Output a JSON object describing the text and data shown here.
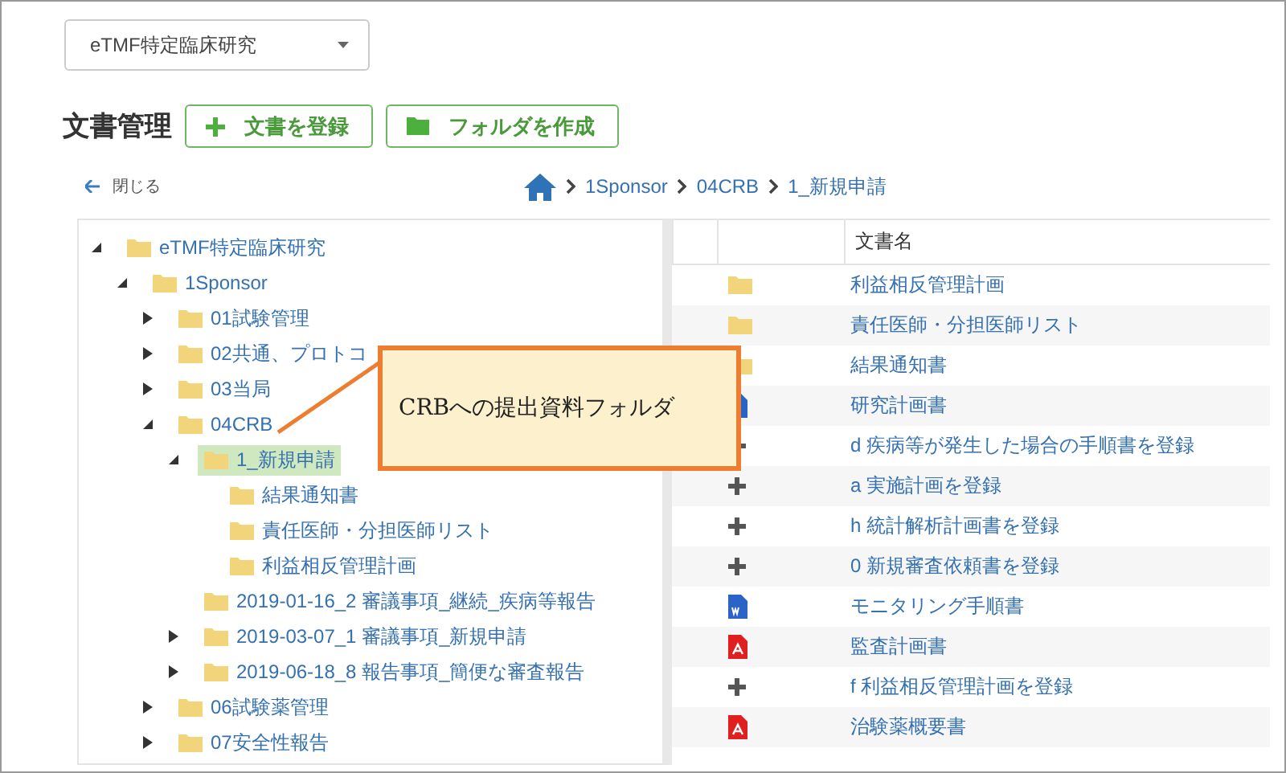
{
  "project_select": {
    "value": "eTMF特定臨床研究"
  },
  "page_title": "文書管理",
  "actions": [
    {
      "label": "文書を登録",
      "kind": "add"
    },
    {
      "label": "フォルダを作成",
      "kind": "folder"
    }
  ],
  "close_link": "閉じる",
  "breadcrumb": [
    "1Sponsor",
    "04CRB",
    "1_新規申請"
  ],
  "tree": [
    {
      "label": "eTMF特定臨床研究",
      "expanded": true,
      "selected": false,
      "children": [
        {
          "label": "1Sponsor",
          "expanded": true,
          "selected": false,
          "children": [
            {
              "label": "01試験管理",
              "expanded": false,
              "selected": false
            },
            {
              "label": "02共通、プロトコ",
              "expanded": false,
              "selected": false
            },
            {
              "label": "03当局",
              "expanded": false,
              "selected": false
            },
            {
              "label": "04CRB",
              "expanded": true,
              "selected": false,
              "children": [
                {
                  "label": "1_新規申請",
                  "expanded": true,
                  "selected": true,
                  "children": [
                    {
                      "label": "結果通知書",
                      "selected": false
                    },
                    {
                      "label": "責任医師・分担医師リスト",
                      "selected": false
                    },
                    {
                      "label": "利益相反管理計画",
                      "selected": false
                    }
                  ]
                },
                {
                  "label": "2019-01-16_2 審議事項_継続_疾病等報告",
                  "selected": false
                },
                {
                  "label": "2019-03-07_1 審議事項_新規申請",
                  "expanded": false,
                  "selected": false
                },
                {
                  "label": "2019-06-18_8 報告事項_簡便な審査報告",
                  "expanded": false,
                  "selected": false
                }
              ]
            },
            {
              "label": "06試験薬管理",
              "expanded": false,
              "selected": false
            },
            {
              "label": "07安全性報告",
              "expanded": false,
              "selected": false
            }
          ]
        }
      ]
    }
  ],
  "table": {
    "columns": [
      "文書名"
    ],
    "rows": [
      {
        "kind": "folder",
        "name": "利益相反管理計画"
      },
      {
        "kind": "folder",
        "name": "責任医師・分担医師リスト"
      },
      {
        "kind": "folder",
        "name": "結果通知書"
      },
      {
        "kind": "word",
        "name": "研究計画書"
      },
      {
        "kind": "add",
        "name": "d 疾病等が発生した場合の手順書を登録"
      },
      {
        "kind": "add",
        "name": "a 実施計画を登録"
      },
      {
        "kind": "add",
        "name": "h 統計解析計画書を登録"
      },
      {
        "kind": "add",
        "name": "0 新規審査依頼書を登録"
      },
      {
        "kind": "word",
        "name": "モニタリング手順書"
      },
      {
        "kind": "pdf",
        "name": "監査計画書"
      },
      {
        "kind": "add",
        "name": "f 利益相反管理計画を登録"
      },
      {
        "kind": "pdf",
        "name": "治験薬概要書"
      }
    ]
  },
  "callout": {
    "text": "CRBへの提出資料フォルダ"
  }
}
